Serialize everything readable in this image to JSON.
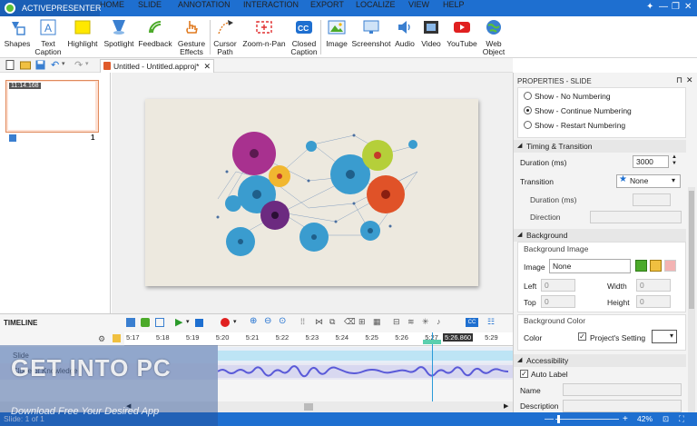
{
  "app": {
    "name": "ACTIVEPRESENTER"
  },
  "menu": {
    "tabs": [
      "HOME",
      "SLIDE",
      "ANNOTATION",
      "INTERACTION",
      "EXPORT",
      "LOCALIZE",
      "VIEW",
      "HELP"
    ],
    "active": "ANNOTATION"
  },
  "ribbon": {
    "items": [
      {
        "label1": "Shapes",
        "label2": ""
      },
      {
        "label1": "Text",
        "label2": "Caption"
      },
      {
        "label1": "Highlight",
        "label2": ""
      },
      {
        "label1": "Spotlight",
        "label2": ""
      },
      {
        "label1": "Feedback",
        "label2": ""
      },
      {
        "label1": "Gesture",
        "label2": "Effects"
      },
      {
        "label1": "Cursor",
        "label2": "Path"
      },
      {
        "label1": "Zoom-n-Pan",
        "label2": ""
      },
      {
        "label1": "Closed",
        "label2": "Caption"
      },
      {
        "label1": "Image",
        "label2": ""
      },
      {
        "label1": "Screenshot",
        "label2": ""
      },
      {
        "label1": "Audio",
        "label2": ""
      },
      {
        "label1": "Video",
        "label2": ""
      },
      {
        "label1": "YouTube",
        "label2": ""
      },
      {
        "label1": "Web",
        "label2": "Object"
      }
    ]
  },
  "document": {
    "tab_title": "Untitled - Untitled.approj*"
  },
  "slide_pane": {
    "thumb_time": "11:14.168",
    "thumb_number": "1"
  },
  "properties": {
    "header": "PROPERTIES - SLIDE",
    "numbering": [
      "Show - No Numbering",
      "Show - Continue Numbering",
      "Show - Restart Numbering"
    ],
    "timing_header": "Timing & Transition",
    "duration_label": "Duration (ms)",
    "duration_value": "3000",
    "transition_label": "Transition",
    "transition_value": "None",
    "sub_duration_label": "Duration (ms)",
    "direction_label": "Direction",
    "background_header": "Background",
    "bg_image_label": "Background Image",
    "image_label": "Image",
    "image_value": "None",
    "left_label": "Left",
    "top_label": "Top",
    "width_label": "Width",
    "height_label": "Height",
    "left_value": "0",
    "top_value": "0",
    "width_value": "0",
    "height_value": "0",
    "bg_color_label": "Background Color",
    "color_label": "Color",
    "project_setting": "Project's Setting",
    "accessibility_header": "Accessibility",
    "auto_label": "Auto Label",
    "name_label": "Name",
    "description_label": "Description"
  },
  "timeline": {
    "title": "TIMELINE",
    "ticks": [
      "5:17",
      "5:18",
      "5:19",
      "5:20",
      "5:21",
      "5:22",
      "5:23",
      "5:24",
      "5:25",
      "5:26",
      "5:27",
      "5:28",
      "5:29"
    ],
    "playhead": "5:26.860",
    "tracks": [
      "Slide",
      "Clone of Knowledge"
    ]
  },
  "status": {
    "slide": "Slide: 1 of 1",
    "zoom": "42%"
  },
  "watermark": {
    "title": "GET INTO PC",
    "subtitle": "Download Free Your Desired App"
  },
  "colors": {
    "accent": "#1e6fd0"
  }
}
